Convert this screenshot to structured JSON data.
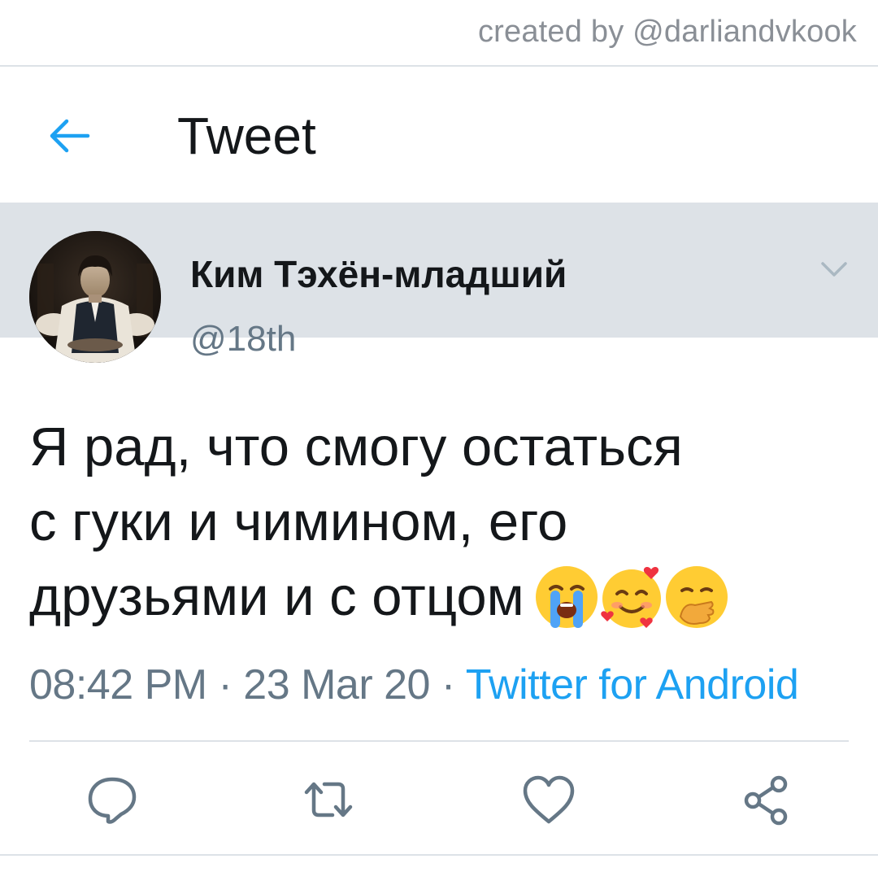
{
  "watermark": "created by @darliandvkook",
  "header": {
    "title": "Tweet",
    "back_icon": "arrow-left-icon"
  },
  "author": {
    "display_name": "Ким Тэхён-младший",
    "handle": "@18th",
    "avatar": "profile-photo"
  },
  "tweet": {
    "lines": [
      "Я рад, что смогу остаться",
      "с гуки и чимином, его",
      "друзьями и с отцом"
    ],
    "emojis": [
      "loudly-crying-face",
      "smiling-face-with-hearts",
      "face-with-hand-over-mouth"
    ]
  },
  "meta": {
    "time": "08:42 PM",
    "separator": " · ",
    "date": "23 Mar 20",
    "source": "Twitter for Android"
  },
  "actions": [
    "reply-icon",
    "retweet-icon",
    "like-icon",
    "share-icon"
  ],
  "colors": {
    "accent": "#1da1f2",
    "text": "#14171a",
    "muted": "#657786",
    "icon": "#657786",
    "divider": "#dde2e7"
  }
}
